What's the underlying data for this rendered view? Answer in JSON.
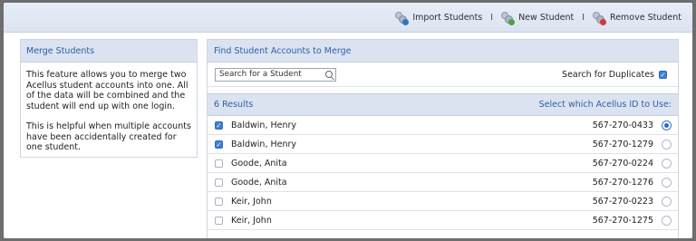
{
  "toolbar": {
    "import_label": "Import Students",
    "new_label": "New Student",
    "remove_label": "Remove Student",
    "separator": "I"
  },
  "merge_panel": {
    "title": "Merge Students",
    "paragraph1": "This feature allows you to merge two Acellus student accounts into one.  All of the data will be combined and the student will end up with one login.",
    "paragraph2": "This is helpful when multiple accounts have been accidentally created for one student."
  },
  "find_panel": {
    "title": "Find Student Accounts to Merge",
    "search_placeholder": "Search for a Student",
    "duplicates_label": "Search for Duplicates",
    "duplicates_checked": true
  },
  "results": {
    "count_label": "6 Results",
    "select_label": "Select which Acellus ID to Use:",
    "rows": [
      {
        "name": "Baldwin, Henry",
        "id": "567-270-0433",
        "checked": true,
        "selected": true
      },
      {
        "name": "Baldwin, Henry",
        "id": "567-270-1279",
        "checked": true,
        "selected": false
      },
      {
        "name": "Goode, Anita",
        "id": "567-270-0224",
        "checked": false,
        "selected": false
      },
      {
        "name": "Goode, Anita",
        "id": "567-270-1276",
        "checked": false,
        "selected": false
      },
      {
        "name": "Keir, John",
        "id": "567-270-0223",
        "checked": false,
        "selected": false
      },
      {
        "name": "Keir, John",
        "id": "567-270-1275",
        "checked": false,
        "selected": false
      }
    ]
  },
  "colors": {
    "accent": "#2d5fa6",
    "header_bg": "#dbe3f1",
    "check_on": "#3d7fd6"
  }
}
